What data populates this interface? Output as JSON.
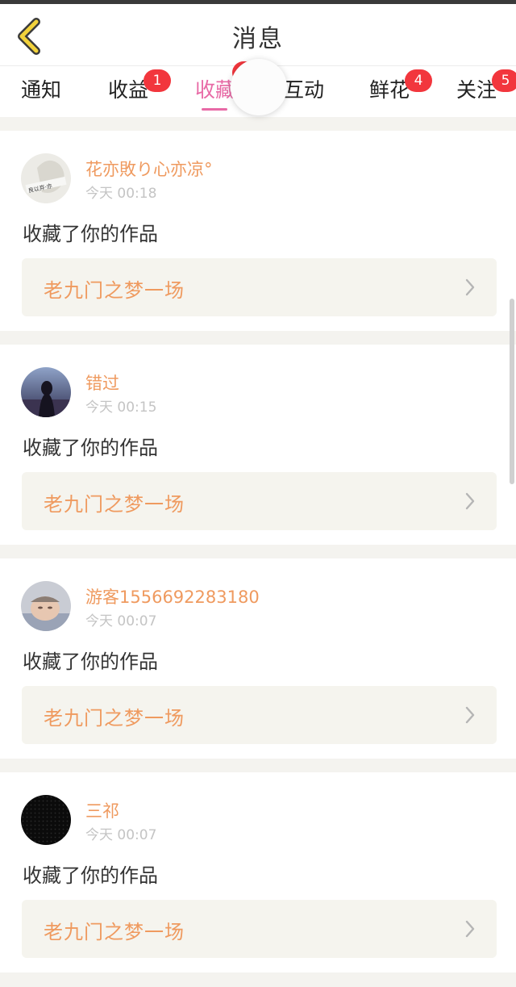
{
  "header": {
    "title": "消息"
  },
  "tabs": [
    {
      "label": "通知",
      "badge": ""
    },
    {
      "label": "收益",
      "badge": "1"
    },
    {
      "label": "收藏",
      "badge": "",
      "active": true
    },
    {
      "label": "互动",
      "badge": ""
    },
    {
      "label": "鲜花",
      "badge": "4"
    },
    {
      "label": "关注",
      "badge": "5"
    }
  ],
  "feed": [
    {
      "user": "花亦敗り心亦凉°",
      "time": "今天 00:18",
      "action": "收藏了你的作品",
      "work": "老九门之梦一场",
      "avatar_icon": "avatar-sketch-icon"
    },
    {
      "user": "错过",
      "time": "今天 00:15",
      "action": "收藏了你的作品",
      "work": "老九门之梦一场",
      "avatar_icon": "avatar-silhouette-icon"
    },
    {
      "user": "游客1556692283180",
      "time": "今天 00:07",
      "action": "收藏了你的作品",
      "work": "老九门之梦一场",
      "avatar_icon": "avatar-baby-icon"
    },
    {
      "user": "三祁",
      "time": "今天 00:07",
      "action": "收藏了你的作品",
      "work": "老九门之梦一场",
      "avatar_icon": "avatar-dark-pattern-icon"
    }
  ],
  "colors": {
    "accent_pink": "#e86aa6",
    "accent_orange": "#ef9a5f",
    "badge_red": "#f2363d",
    "back_arrow_yellow": "#f2d23b"
  }
}
